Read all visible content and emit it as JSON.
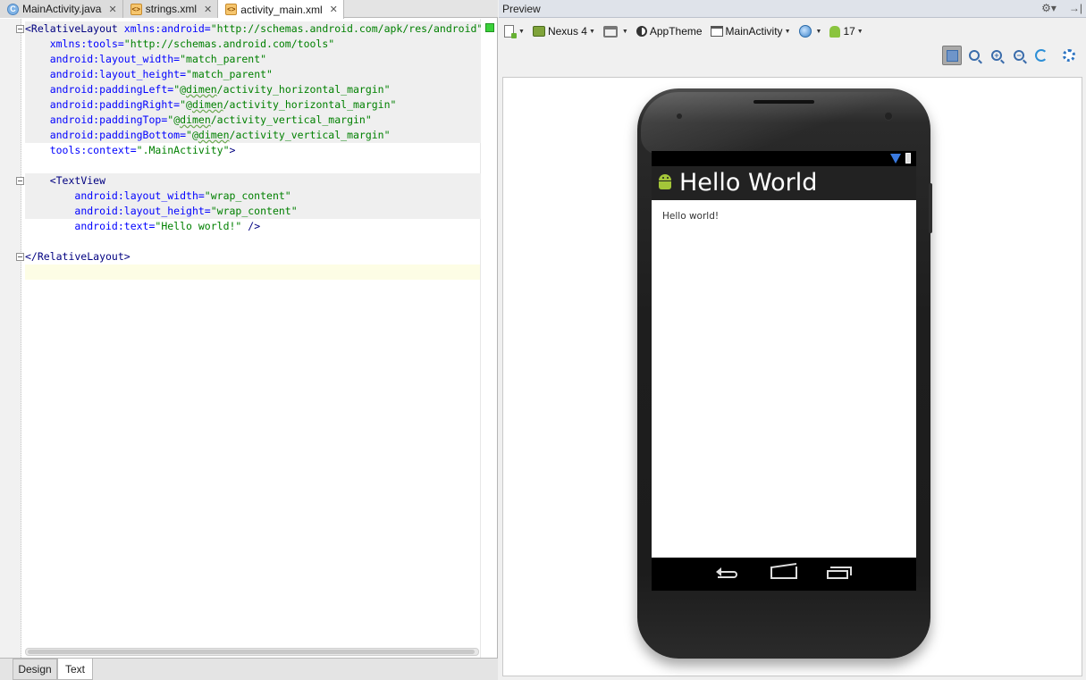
{
  "editor": {
    "tabs": [
      {
        "label": "MainActivity.java",
        "icon": "java-class-icon",
        "active": false
      },
      {
        "label": "strings.xml",
        "icon": "xml-file-icon",
        "active": false
      },
      {
        "label": "activity_main.xml",
        "icon": "xml-file-icon",
        "active": true
      }
    ],
    "close_glyph": "✕",
    "lines": [
      {
        "l": "<RelativeLayout",
        "a": " xmlns:android=",
        "v": "\"http://schemas.android.com/apk/res/android\""
      },
      {
        "i": "    ",
        "a": "xmlns:tools=",
        "v": "\"http://schemas.android.com/tools\""
      },
      {
        "i": "    ",
        "a": "android:layout_width=",
        "v": "\"match_parent\""
      },
      {
        "i": "    ",
        "a": "android:layout_height=",
        "v": "\"match_parent\""
      },
      {
        "i": "    ",
        "a": "android:paddingLeft=",
        "v1": "\"@",
        "sq": "dimen",
        "v2": "/activity_horizontal_margin\""
      },
      {
        "i": "    ",
        "a": "android:paddingRight=",
        "v1": "\"@",
        "sq": "dimen",
        "v2": "/activity_horizontal_margin\""
      },
      {
        "i": "    ",
        "a": "android:paddingTop=",
        "v1": "\"@",
        "sq": "dimen",
        "v2": "/activity_vertical_margin\""
      },
      {
        "i": "    ",
        "a": "android:paddingBottom=",
        "v1": "\"@",
        "sq": "dimen",
        "v2": "/activity_vertical_margin\""
      },
      {
        "i": "    ",
        "a": "tools:context=",
        "v": "\".MainActivity\"",
        "t": ">"
      },
      {},
      {
        "i": "    ",
        "l": "<TextView"
      },
      {
        "i": "        ",
        "a": "android:layout_width=",
        "v": "\"wrap_content\""
      },
      {
        "i": "        ",
        "a": "android:layout_height=",
        "v": "\"wrap_content\""
      },
      {
        "i": "        ",
        "a": "android:text=",
        "v": "\"Hello world!\"",
        "t": " />"
      },
      {},
      {
        "l": "</RelativeLayout>"
      },
      {}
    ],
    "mode_tabs": {
      "design": "Design",
      "text": "Text"
    }
  },
  "preview": {
    "title": "Preview",
    "title_icons": [
      "⚙▾",
      "→|"
    ],
    "toolbar": {
      "device": "Nexus 4",
      "theme": "AppTheme",
      "activity": "MainActivity",
      "api_level": "17"
    },
    "phone": {
      "app_title": "Hello World",
      "text_view": "Hello world!"
    }
  }
}
